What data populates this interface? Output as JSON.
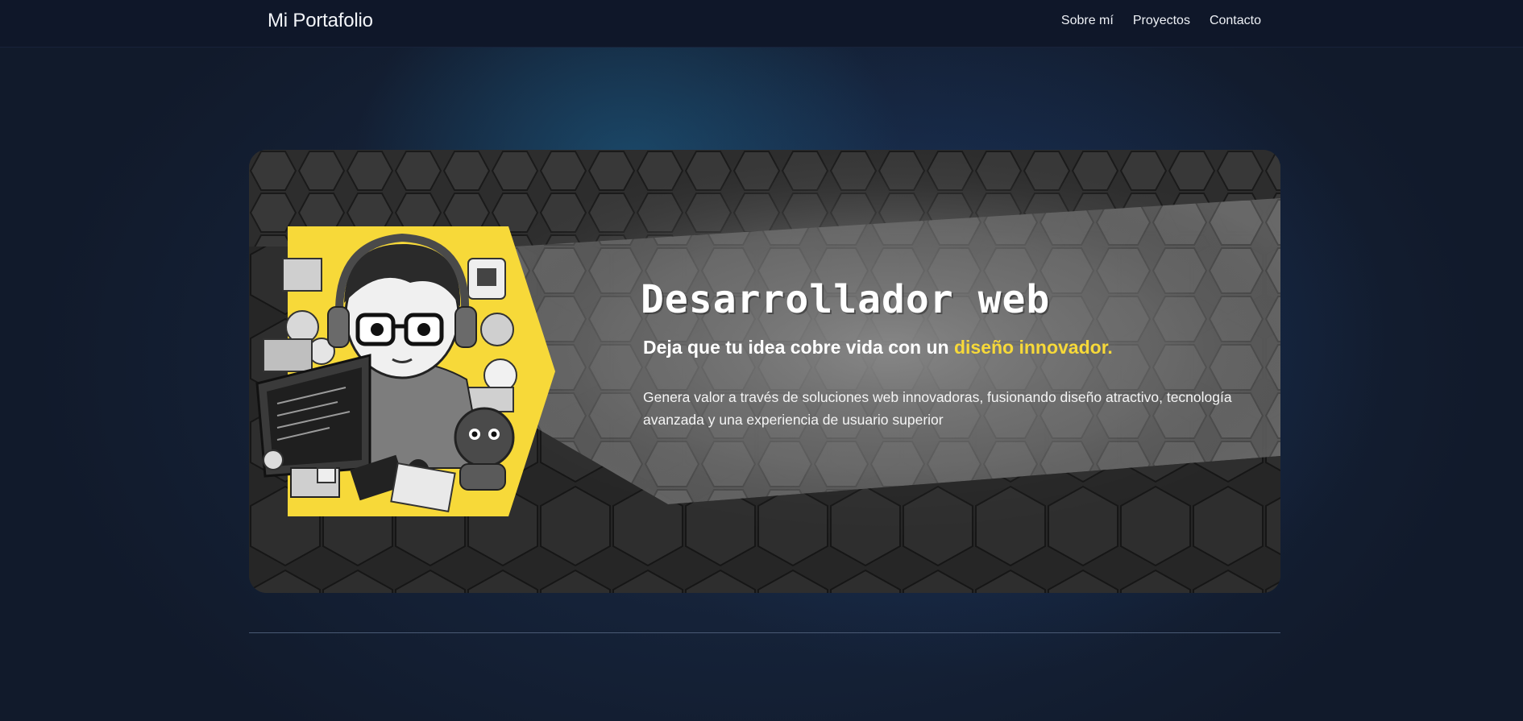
{
  "nav": {
    "brand": "Mi Portafolio",
    "links": [
      {
        "label": "Sobre mí"
      },
      {
        "label": "Proyectos"
      },
      {
        "label": "Contacto"
      }
    ]
  },
  "hero": {
    "title": "Desarrollador web",
    "subtitle_main": "Deja que tu idea cobre vida con un ",
    "subtitle_accent": "diseño innovador.",
    "description": "Genera valor a través de soluciones web innovadoras, fusionando diseño atractivo, tecnología avanzada y una experiencia de usuario superior",
    "illustration": "developer-illustration"
  },
  "colors": {
    "navbar": "#0f1729",
    "background": "#152238",
    "accent": "#f7d939",
    "hero_bg": "#2b2b2b"
  }
}
